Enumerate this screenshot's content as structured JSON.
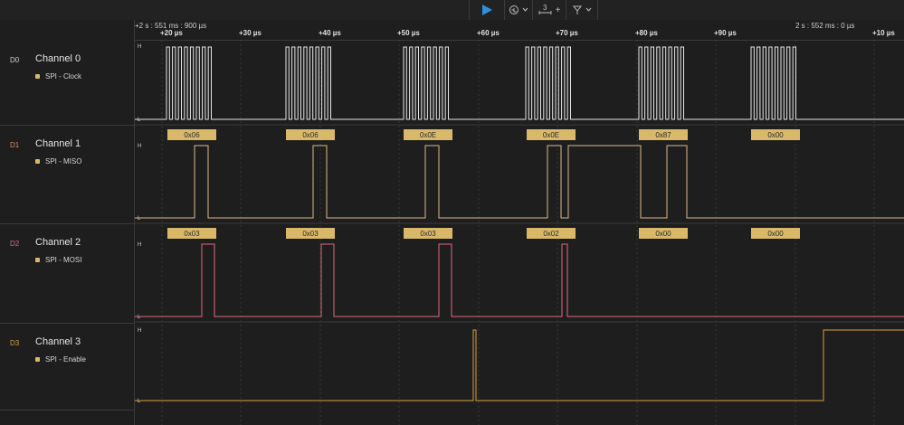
{
  "toolbar": {
    "measure_count": "3",
    "measure_plus": "+"
  },
  "ruler": {
    "start_label": "+2 s : 551 ms : 900 µs",
    "end_label": "2 s : 552 ms : 0 µs",
    "ticks": [
      "+20 µs",
      "+30 µs",
      "+40 µs",
      "+50 µs",
      "+60 µs",
      "+70 µs",
      "+80 µs",
      "+90 µs",
      "+10 µs"
    ]
  },
  "channels": [
    {
      "id": "D0",
      "name": "Channel 0",
      "analyzer": "SPI - Clock",
      "color": "#e6e6e6",
      "id_color": "#cfcfcf"
    },
    {
      "id": "D1",
      "name": "Channel 1",
      "analyzer": "SPI - MISO",
      "color": "#d9b98a",
      "id_color": "#d98a6a"
    },
    {
      "id": "D2",
      "name": "Channel 2",
      "analyzer": "SPI - MOSI",
      "color": "#e06a80",
      "id_color": "#e06a80"
    },
    {
      "id": "D3",
      "name": "Channel 3",
      "analyzer": "SPI - Enable",
      "color": "#d9a040",
      "id_color": "#d9a040"
    }
  ],
  "level_labels": {
    "high": "H",
    "low": "L"
  },
  "miso_bytes": [
    "0x06",
    "0x06",
    "0x0E",
    "0x0E",
    "0x87",
    "0x00"
  ],
  "mosi_bytes": [
    "0x03",
    "0x03",
    "0x03",
    "0x02",
    "0x00",
    "0x00"
  ],
  "colors": {
    "background": "#1e1e1e",
    "grid": "#4a4a4a",
    "byte_badge": "#d9b969",
    "play_button": "#2f8fe0"
  }
}
